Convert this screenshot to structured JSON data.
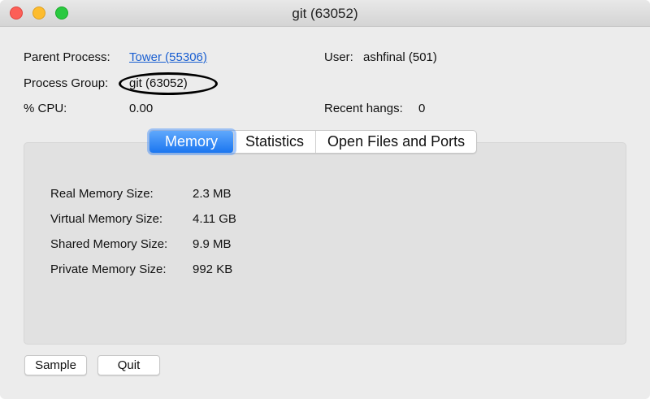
{
  "window": {
    "title": "git (63052)",
    "controls": {
      "close_color": "#fc5f57",
      "minimize_color": "#fdbc2e",
      "zoom_color": "#2ac940"
    }
  },
  "info": {
    "parent_process_label": "Parent Process:",
    "parent_process_value": "Tower (55306)",
    "process_group_label": "Process Group:",
    "process_group_value": "git (63052)",
    "cpu_label": "% CPU:",
    "cpu_value": "0.00",
    "user_label": "User:",
    "user_value": "ashfinal (501)",
    "hangs_label": "Recent hangs:",
    "hangs_value": "0"
  },
  "tabs": [
    {
      "label": "Memory",
      "active": true
    },
    {
      "label": "Statistics"
    },
    {
      "label": "Open Files and Ports"
    }
  ],
  "memory": [
    {
      "label": "Real Memory Size:",
      "value": "2.3 MB"
    },
    {
      "label": "Virtual Memory Size:",
      "value": "4.11 GB"
    },
    {
      "label": "Shared Memory Size:",
      "value": "9.9 MB"
    },
    {
      "label": "Private Memory Size:",
      "value": "992 KB"
    }
  ],
  "buttons": {
    "sample": "Sample",
    "quit": "Quit"
  }
}
